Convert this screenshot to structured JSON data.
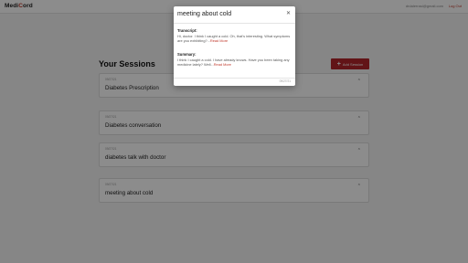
{
  "header": {
    "logo_prefix": "Medi",
    "logo_accent": "C",
    "logo_suffix": "ord",
    "user_email": "drdalerrasi@gmail.com",
    "logout_label": "Log Out"
  },
  "sessions": {
    "title": "Your Sessions",
    "add_label": "Add Session",
    "items": [
      {
        "date": "09/27/21",
        "title": "Diabetes Prescription"
      },
      {
        "date": "09/27/21",
        "title": "Diabetes conversation"
      },
      {
        "date": "09/27/21",
        "title": "diabetes talk with doctor"
      },
      {
        "date": "09/27/21",
        "title": "meeting about cold"
      }
    ]
  },
  "modal": {
    "title": "meeting about cold",
    "close_icon": "close-icon",
    "transcript_label": "Transcript:",
    "transcript_text": "Hi, doctor. I think I caught a cold. Oh, that's interesting. What symptoms are you exhibiting?...",
    "transcript_more": "Read More",
    "summary_label": "Summary:",
    "summary_text": "I think I caught a cold. I have already knows. Have you been taking any medicine lately? Well...",
    "summary_more": "Read More",
    "date": "09/27/21"
  },
  "colors": {
    "accent": "#b3262b",
    "overlay": "rgba(0,0,0,0.45)"
  }
}
